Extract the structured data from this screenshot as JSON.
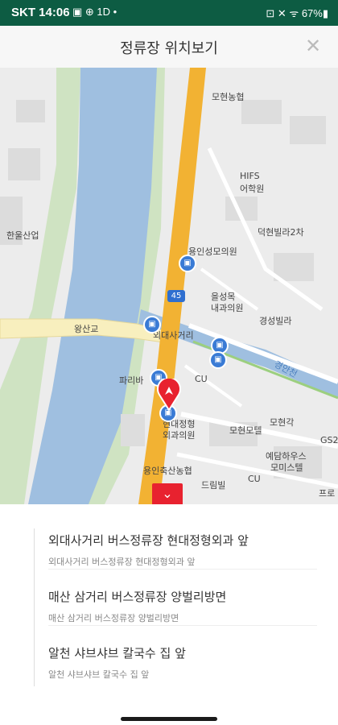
{
  "status": {
    "time": "SKT 14:06",
    "left_icons": "▣ ⊕ 1D •",
    "right_icons": "⊡ ✕ ᯤ 67%▮"
  },
  "header": {
    "title": "정류장 위치보기",
    "close": "✕"
  },
  "map": {
    "labels": {
      "moheon_nh": "모현농협",
      "hifs": "HIFS",
      "hifs2": "어학원",
      "hanul": "한울산업",
      "dukhyun": "덕현빌라2차",
      "yongin_clinic": "용인성모의원",
      "eulsung1": "을성목",
      "eulsung2": "내과의원",
      "kyungsung": "경성빌라",
      "wangsan": "왕산교",
      "oedae": "외대사거리",
      "paris": "파리바",
      "cu1": "CU",
      "hyundae1": "현대정형",
      "hyundae2": "외과의원",
      "moheon_motel": "모현모텔",
      "moheonkak": "모현각",
      "yedam1": "예담하우스",
      "yedam2": "모미스텔",
      "gs": "GS2",
      "yongin_nh": "용인축산농협",
      "dream": "드림빌",
      "cu2": "CU",
      "pro": "프로",
      "gyeongan": "경안천"
    },
    "route": "45",
    "collapse": "⌄"
  },
  "stops": [
    {
      "name": "외대사거리 버스정류장 현대정형외과 앞",
      "sub": "외대사거리 버스정류장 현대정형외과 앞"
    },
    {
      "name": "매산 삼거리 버스정류장 양벌리방면",
      "sub": "매산 삼거리 버스정류장 양벌리방면"
    },
    {
      "name": "알천 샤브샤브 칼국수 집 앞",
      "sub": "알천 샤브샤브 칼국수 집 앞"
    }
  ],
  "colors": {
    "status_bar": "#0d5c43",
    "road": "#f2b233",
    "river": "#9fbfe0",
    "accent": "#e8222f",
    "bus": "#3a7bd5"
  }
}
